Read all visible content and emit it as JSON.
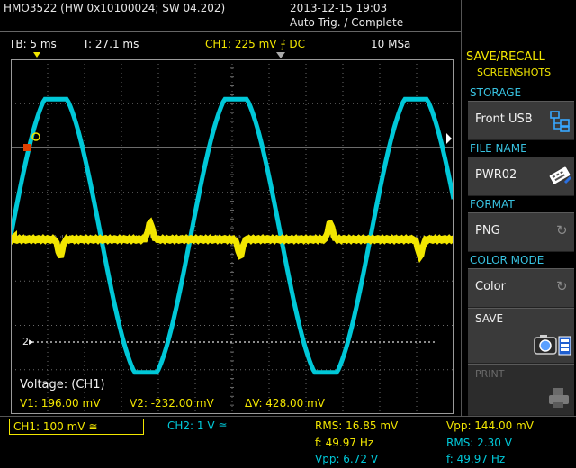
{
  "header": {
    "device": "HMO3522 (HW 0x10100024; SW 04.202)",
    "datetime": "2013-12-15 19:03",
    "status": "Auto-Trig. / Complete"
  },
  "topbar": {
    "timebase": "TB: 5 ms",
    "trigger_time": "T: 27.1 ms",
    "ch1_trigger": "CH1: 225 mV ⨍ DC",
    "samplerate": "10 MSa"
  },
  "menu": {
    "title": "SAVE/RECALL",
    "subtitle": "SCREENSHOTS",
    "storage_label": "STORAGE",
    "storage_value": "Front USB",
    "filename_label": "FILE NAME",
    "filename_value": "PWR02",
    "format_label": "FORMAT",
    "format_value": "PNG",
    "colormode_label": "COLOR MODE",
    "colormode_value": "Color",
    "save_label": "SAVE",
    "print_label": "PRINT"
  },
  "cursor": {
    "title": "Voltage: (CH1)",
    "v1": "V1: 196.00 mV",
    "v2": "V2: -232.00 mV",
    "dv": "ΔV: 428.00 mV"
  },
  "channels": {
    "ch1": "CH1: 100 mV ≅",
    "ch2": "CH2: 1 V ≅",
    "marker2": "2"
  },
  "measurements": {
    "rms1": "RMS: 16.85 mV",
    "f1": "f: 49.97 Hz",
    "vpp2": "Vpp: 6.72 V",
    "vpp1": "Vpp: 144.00 mV",
    "rms2": "RMS: 2.30 V",
    "f2": "f: 49.97 Hz"
  },
  "colors": {
    "ch1": "#f2e600",
    "ch2": "#00c8d8",
    "accent": "#38c2e0",
    "grid": "#6a6a6a"
  },
  "icons": {
    "storage": "usb-folder-icon",
    "filename": "keyboard-edit-icon",
    "save": "camera-save-icon",
    "print": "printer-icon"
  }
}
